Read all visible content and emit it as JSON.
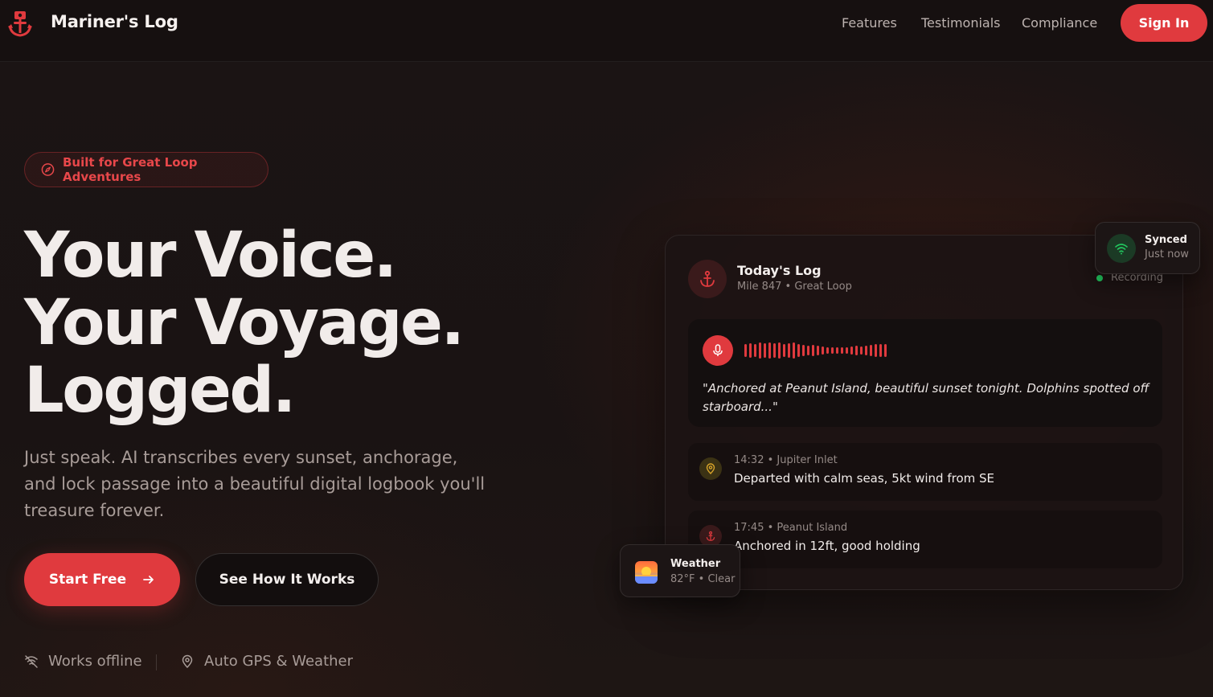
{
  "nav": {
    "brand": "Mariner's Log",
    "links": [
      "Features",
      "Testimonials",
      "Compliance"
    ],
    "signin_label": "Sign In"
  },
  "hero": {
    "badge": "Built for Great Loop Adventures",
    "headline": [
      "Your Voice.",
      "Your Voyage.",
      "Logged."
    ],
    "subtext": "Just speak. AI transcribes every sunset, anchorage, and lock passage into a beautiful digital logbook you'll treasure forever.",
    "cta_primary": "Start Free",
    "cta_secondary": "See How It Works",
    "features": [
      "Works offline",
      "Auto GPS & Weather"
    ]
  },
  "card": {
    "title": "Today's Log",
    "subtitle": "Mile 847 • Great Loop",
    "status": "Recording",
    "quote": "\"Anchored at Peanut Island, beautiful sunset tonight. Dolphins spotted off starboard...\"",
    "entries": [
      {
        "meta": "14:32 • Jupiter Inlet",
        "text": "Departed with calm seas, 5kt wind from SE",
        "icon": "map-pin-icon"
      },
      {
        "meta": "17:45 • Peanut Island",
        "text": "Anchored in 12ft, good holding",
        "icon": "anchor-icon"
      }
    ]
  },
  "synced": {
    "title": "Synced",
    "subtitle": "Just now"
  },
  "weather": {
    "title": "Weather",
    "subtitle": "82°F • Clear"
  },
  "colors": {
    "accent": "#e03a3e",
    "status_green": "#22c55e",
    "background": "#1a1313"
  }
}
